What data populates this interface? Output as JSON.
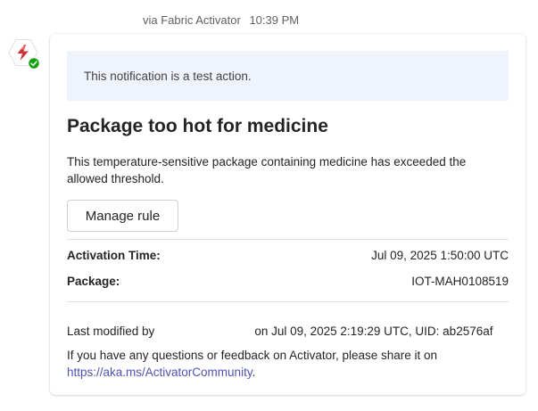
{
  "message": {
    "sender_via": "via Fabric Activator",
    "timestamp": "10:39 PM",
    "avatar_icon": "activator-lightning-icon",
    "status_icon": "available-check-icon",
    "colors": {
      "avatar_accent": "#d13438",
      "status_green": "#13a10e",
      "banner_bg": "#eff3fc",
      "link": "#4f52b2"
    }
  },
  "card": {
    "banner_text": "This notification is a test action.",
    "title": "Package too hot for medicine",
    "description": "This temperature-sensitive package containing medicine has exceeded the allowed threshold.",
    "manage_rule_label": "Manage rule",
    "facts": [
      {
        "label": "Activation Time:",
        "value": "Jul 09, 2025 1:50:00 UTC"
      },
      {
        "label": "Package:",
        "value": "IOT-MAH0108519"
      }
    ],
    "modified_prefix": "Last modified by",
    "modified_suffix": "on Jul 09, 2025 2:19:29 UTC, UID: ab2576af",
    "feedback_text": "If you have any questions or feedback on Activator, please share it on",
    "feedback_link": "https://aka.ms/ActivatorCommunity",
    "feedback_end": "."
  }
}
